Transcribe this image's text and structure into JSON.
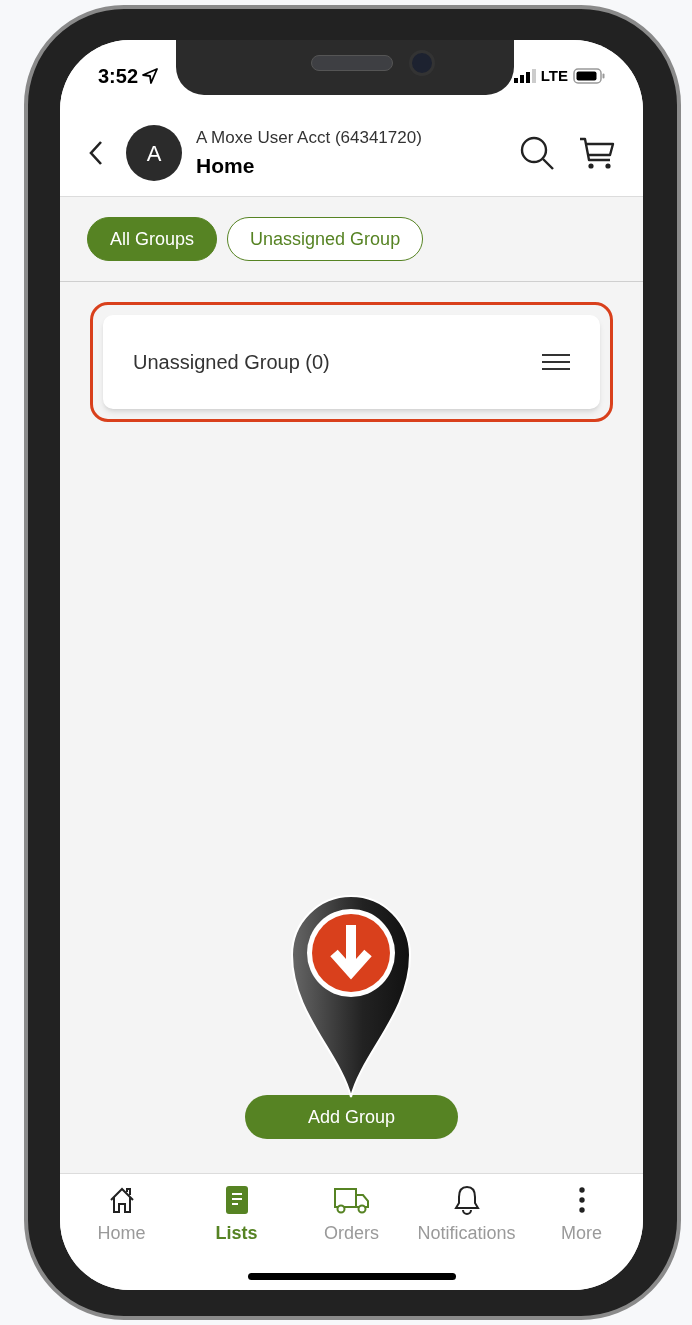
{
  "status_bar": {
    "time": "3:52",
    "network": "LTE"
  },
  "header": {
    "avatar_letter": "A",
    "account": "A Moxe User Acct (64341720)",
    "title": "Home"
  },
  "filters": [
    {
      "label": "All Groups",
      "selected": true
    },
    {
      "label": "Unassigned Group",
      "selected": false
    }
  ],
  "groups": [
    {
      "label": "Unassigned Group (0)",
      "highlighted": true
    }
  ],
  "add_button": "Add Group",
  "tabs": [
    {
      "label": "Home",
      "selected": false
    },
    {
      "label": "Lists",
      "selected": true
    },
    {
      "label": "Orders",
      "selected": false
    },
    {
      "label": "Notifications",
      "selected": false
    },
    {
      "label": "More",
      "selected": false
    }
  ]
}
